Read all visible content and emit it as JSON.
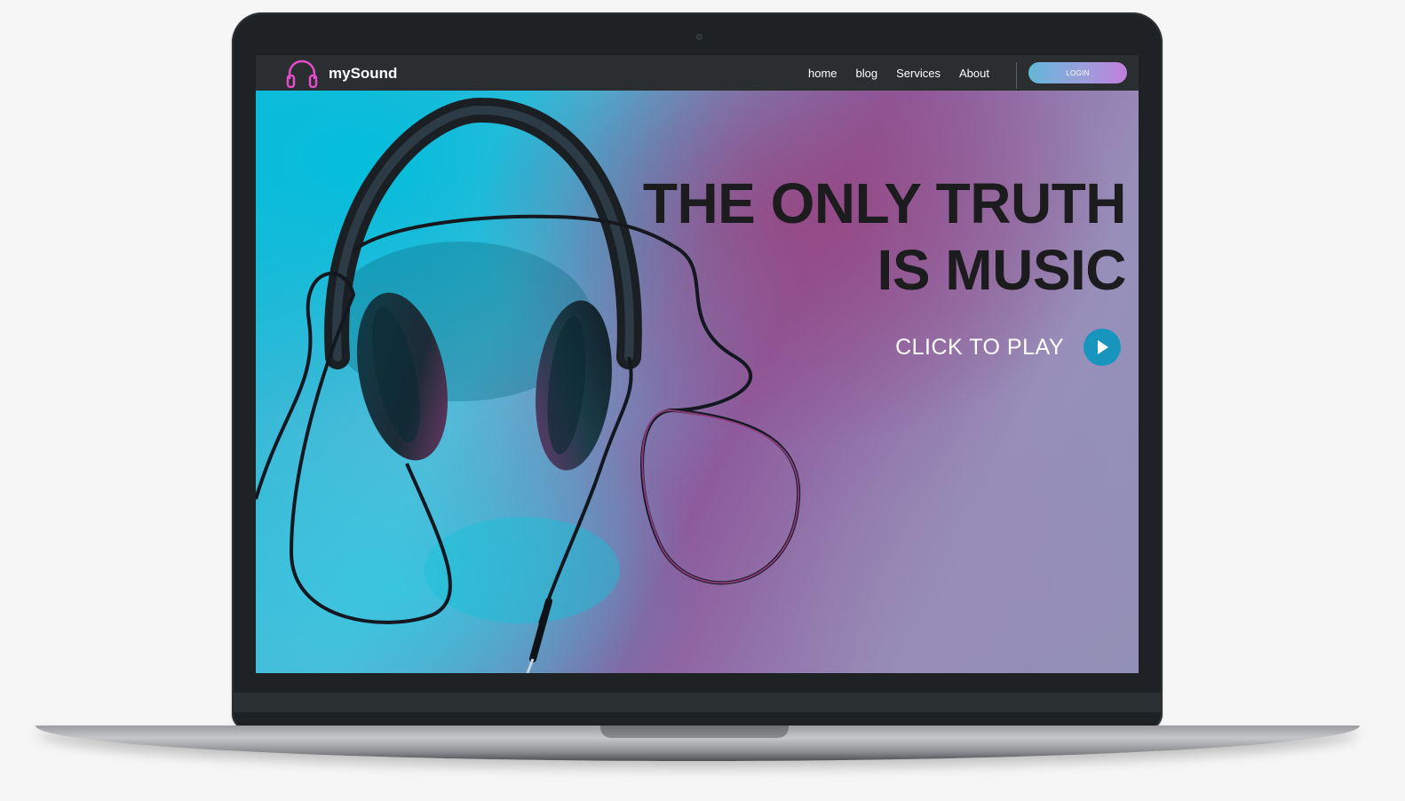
{
  "app": {
    "brand": "mySound",
    "accent_color": "#e54cc9"
  },
  "nav": {
    "items": [
      {
        "label": "home"
      },
      {
        "label": "blog"
      },
      {
        "label": "Services"
      },
      {
        "label": "About"
      }
    ],
    "login_label": "LOGIN"
  },
  "hero": {
    "headline_line1": "THE ONLY TRUTH",
    "headline_line2": "IS MUSIC",
    "cta_label": "CLICK TO PLAY",
    "cta_color": "#1795bd",
    "image_subject": "headphones"
  },
  "icons": {
    "logo": "headphones-icon",
    "cta": "play-icon"
  }
}
